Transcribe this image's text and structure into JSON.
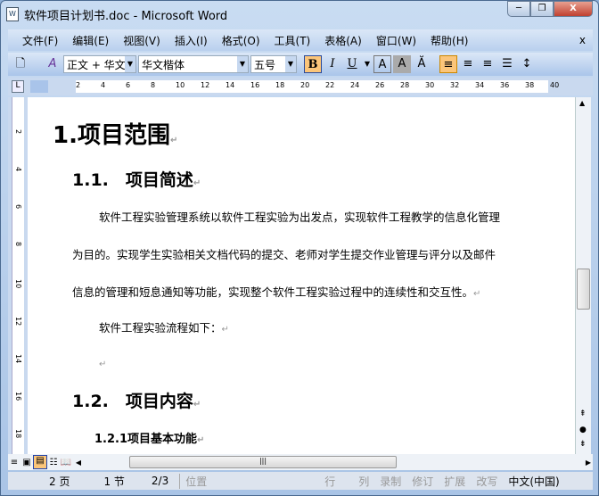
{
  "window": {
    "title": "软件项目计划书.doc - Microsoft Word",
    "minimize": "─",
    "restore": "❐",
    "close": "X"
  },
  "menu": {
    "items": [
      "文件(F)",
      "编辑(E)",
      "视图(V)",
      "插入(I)",
      "格式(O)",
      "工具(T)",
      "表格(A)",
      "窗口(W)",
      "帮助(H)"
    ],
    "close": "x"
  },
  "toolbar": {
    "style": "正文 + 华文",
    "font": "华文楷体",
    "size": "五号",
    "bold": "B",
    "italic": "I",
    "underline": "U"
  },
  "ruler": {
    "ticks": [
      "2",
      "4",
      "6",
      "8",
      "10",
      "12",
      "14",
      "16",
      "18",
      "20",
      "22",
      "24",
      "26",
      "28",
      "30",
      "32",
      "34",
      "36",
      "38",
      "40"
    ]
  },
  "vruler": {
    "ticks": [
      "2",
      "4",
      "6",
      "8",
      "10",
      "12",
      "14",
      "16",
      "18"
    ]
  },
  "document": {
    "h1": "1.项目范围",
    "h2a": "1.1.　项目简述",
    "p1a": "软件工程实验管理系统以软件工程实验为出发点，实现软件工程教学的信息化管理",
    "p1b": "为目的。实现学生实验相关文档代码的提交、老师对学生提交作业管理与评分以及邮件",
    "p1c": "信息的管理和短息通知等功能，实现整个软件工程实验过程中的连续性和交互性。",
    "p2": "软件工程实验流程如下：",
    "h2b": "1.2.　项目内容",
    "h3": "1.2.1项目基本功能",
    "mark": "↵"
  },
  "status": {
    "page": "2 页",
    "section": "1 节",
    "pages": "2/3",
    "position": "位置",
    "line": "行",
    "col": "列",
    "rec": "录制",
    "trk": "修订",
    "ext": "扩展",
    "ovr": "改写",
    "lang": "中文(中国)"
  }
}
